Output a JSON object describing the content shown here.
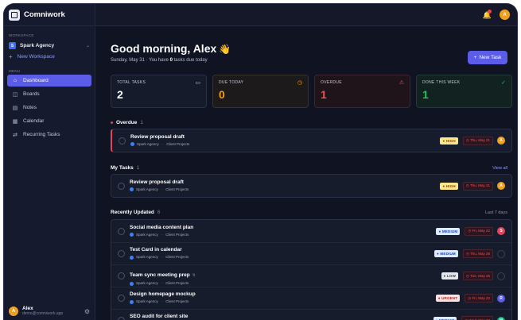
{
  "app": {
    "name": "Comniwork"
  },
  "sidebar": {
    "workspace_label": "WORKSPACE",
    "workspace": {
      "badge": "S",
      "name": "Spark Agency"
    },
    "new_workspace": "New Workspace",
    "menu_label": "MENU",
    "items": [
      {
        "label": "Dashboard",
        "icon": "home-icon",
        "glyph": "⌂"
      },
      {
        "label": "Boards",
        "icon": "board-icon",
        "glyph": "◫"
      },
      {
        "label": "Notes",
        "icon": "note-icon",
        "glyph": "▤"
      },
      {
        "label": "Calendar",
        "icon": "calendar-icon",
        "glyph": "▦"
      },
      {
        "label": "Recurring Tasks",
        "icon": "repeat-icon",
        "glyph": "⇄"
      }
    ],
    "user": {
      "initial": "A",
      "name": "Alex",
      "email": "demo@comniwork.app"
    }
  },
  "topbar": {
    "avatar": "A"
  },
  "header": {
    "greeting": "Good morning, Alex",
    "wave": "👋",
    "sub_prefix": "Sunday, May 31 · You have ",
    "sub_count": "0",
    "sub_suffix": " tasks due today",
    "new_task": "New Task"
  },
  "stats": [
    {
      "label": "TOTAL TASKS",
      "value": "2",
      "icon": "inbox-icon",
      "glyph": "▭"
    },
    {
      "label": "DUE TODAY",
      "value": "0",
      "icon": "clock-icon",
      "glyph": "◷"
    },
    {
      "label": "OVERDUE",
      "value": "1",
      "icon": "warning-icon",
      "glyph": "⚠"
    },
    {
      "label": "DONE THIS WEEK",
      "value": "1",
      "icon": "check-icon",
      "glyph": "✓"
    }
  ],
  "overdue": {
    "title": "Overdue",
    "count": "1",
    "tasks": [
      {
        "title": "Review proposal draft",
        "workspace": "Spark Agency",
        "project": "Client Projects",
        "priority": "HIGH",
        "due": "Thu, May 21",
        "assignee": "A"
      }
    ]
  },
  "my_tasks": {
    "title": "My Tasks",
    "count": "1",
    "link": "View all",
    "tasks": [
      {
        "title": "Review proposal draft",
        "workspace": "Spark Agency",
        "project": "Client Projects",
        "priority": "HIGH",
        "due": "Thu, May 21",
        "assignee": "A"
      }
    ]
  },
  "recent": {
    "title": "Recently Updated",
    "count": "6",
    "range": "Last 7 days",
    "tasks": [
      {
        "title": "Social media content plan",
        "workspace": "Spark Agency",
        "project": "Client Projects",
        "priority": "MEDIUM",
        "due": "Fri, May 22",
        "assignee": "S"
      },
      {
        "title": "Test Card in calendar",
        "workspace": "Spark Agency",
        "project": "Client Projects",
        "priority": "MEDIUM",
        "due": "Thu, May 28",
        "assignee": ""
      },
      {
        "title": "Team sync meeting prep",
        "workspace": "Spark Agency",
        "project": "Client Projects",
        "priority": "LOW",
        "due": "Tue, May 26",
        "assignee": ""
      },
      {
        "title": "Design homepage mockup",
        "workspace": "Spark Agency",
        "project": "Client Projects",
        "priority": "URGENT",
        "due": "Fri, May 22",
        "assignee": "R"
      },
      {
        "title": "SEO audit for client site",
        "workspace": "Spark Agency",
        "project": "Client Projects",
        "priority": "MEDIUM",
        "due": "Wed, May 27",
        "assignee": "M"
      }
    ]
  }
}
